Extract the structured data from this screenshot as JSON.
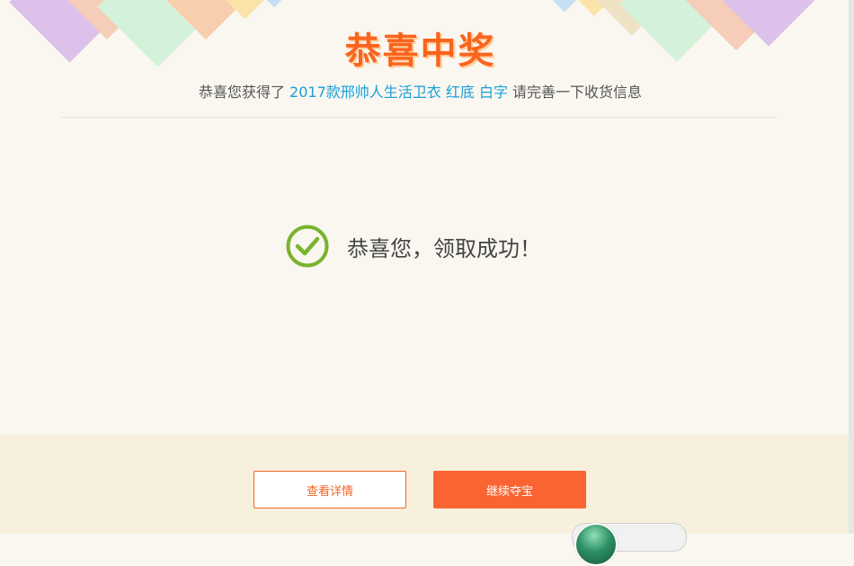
{
  "header": {
    "title": "恭喜中奖",
    "subtitle_prefix": "恭喜您获得了",
    "prize_name": "2017款邢帅人生活卫衣 红底 白字",
    "subtitle_suffix": "请完善一下收货信息"
  },
  "status": {
    "icon": "check-circle-icon",
    "message": "恭喜您，领取成功！"
  },
  "actions": {
    "view_details_label": "查看详情",
    "continue_label": "继续夺宝"
  },
  "colors": {
    "accent_orange": "#fa6432",
    "title_orange": "#fa641e",
    "prize_blue": "#1aa0d8",
    "success_green": "#7ab32e",
    "background": "#f9f7f0",
    "footer_background": "#f7f0dd"
  }
}
